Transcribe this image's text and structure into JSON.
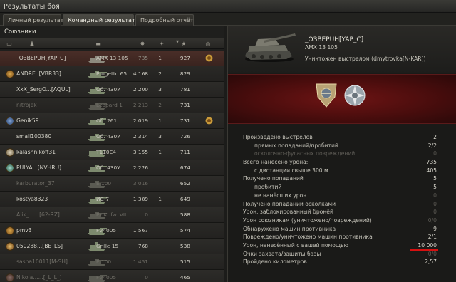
{
  "window": {
    "title": "Результаты боя"
  },
  "tabs": [
    {
      "label": "Личный результат",
      "active": false
    },
    {
      "label": "Командный результат",
      "active": true
    },
    {
      "label": "Подробный отчёт",
      "active": false
    }
  ],
  "team": {
    "title": "Союзники",
    "players": [
      {
        "name": "_OЗВЕРUH[YAP_C]",
        "vehicle": "AMX 13 105",
        "damage": "735",
        "kills": "1",
        "xp": "927",
        "self": true,
        "dead": false,
        "clan": false,
        "medal": true
      },
      {
        "name": "ANDRE..[VBR33]",
        "vehicle": "Progetto 65",
        "damage": "4 168",
        "kills": "2",
        "xp": "829",
        "self": false,
        "dead": false,
        "clan": true,
        "medal": false
      },
      {
        "name": "XxX_SergO...[AQUL]",
        "vehicle": "Об. 430У",
        "damage": "2 200",
        "kills": "3",
        "xp": "781",
        "self": false,
        "dead": false,
        "clan": false,
        "medal": false
      },
      {
        "name": "nitrojek",
        "vehicle": "Leopard 1",
        "damage": "2 213",
        "kills": "2",
        "xp": "731",
        "self": false,
        "dead": true,
        "clan": false,
        "medal": false
      },
      {
        "name": "Genik59",
        "vehicle": "Об. 261",
        "damage": "2 019",
        "kills": "1",
        "xp": "731",
        "self": false,
        "dead": false,
        "clan": true,
        "medal": true
      },
      {
        "name": "small100380",
        "vehicle": "Об. 430У",
        "damage": "2 314",
        "kills": "3",
        "xp": "726",
        "self": false,
        "dead": false,
        "clan": false,
        "medal": false
      },
      {
        "name": "kalashnikoff31",
        "vehicle": "T110E4",
        "damage": "3 155",
        "kills": "1",
        "xp": "711",
        "self": false,
        "dead": false,
        "clan": true,
        "medal": false
      },
      {
        "name": "PULYA...[NVHRU]",
        "vehicle": "Об. 430У",
        "damage": "2 226",
        "kills": "",
        "xp": "674",
        "self": false,
        "dead": false,
        "clan": true,
        "medal": false
      },
      {
        "name": "karburator_37",
        "vehicle": "E 100",
        "damage": "3 016",
        "kills": "",
        "xp": "652",
        "self": false,
        "dead": true,
        "clan": false,
        "medal": false
      },
      {
        "name": "kostya8323",
        "vehicle": "ИС-7",
        "damage": "1 389",
        "kills": "1",
        "xp": "649",
        "self": false,
        "dead": false,
        "clan": false,
        "medal": false
      },
      {
        "name": "Alik_......[62-RZ]",
        "vehicle": "Pz.Kpfw. VII",
        "damage": "0",
        "kills": "",
        "xp": "588",
        "self": false,
        "dead": true,
        "clan": false,
        "medal": false
      },
      {
        "name": "pmv3",
        "vehicle": "FV4005",
        "damage": "1 567",
        "kills": "",
        "xp": "574",
        "self": false,
        "dead": false,
        "clan": true,
        "medal": false
      },
      {
        "name": "050288...[BE_LS]",
        "vehicle": "Grille 15",
        "damage": "768",
        "kills": "",
        "xp": "538",
        "self": false,
        "dead": false,
        "clan": true,
        "medal": false
      },
      {
        "name": "sasha10011[M-SH]",
        "vehicle": "E 100",
        "damage": "1 451",
        "kills": "",
        "xp": "515",
        "self": false,
        "dead": true,
        "clan": false,
        "medal": false
      },
      {
        "name": "Nikola......[_L_L_]",
        "vehicle": "FV4005",
        "damage": "0",
        "kills": "",
        "xp": "465",
        "self": false,
        "dead": true,
        "clan": true,
        "medal": false
      }
    ]
  },
  "detail": {
    "player_name": "_OЗВЕРUH[YAP_C]",
    "vehicle": "AMX 13 105",
    "status": "Уничтожен выстрелом (dmytrovka[N-KAR])",
    "stats": [
      {
        "label": "Произведено выстрелов",
        "value": "2",
        "sub": false,
        "dim": false
      },
      {
        "label": "прямых попаданий/пробитий",
        "value": "2/2",
        "sub": true,
        "dim": false
      },
      {
        "label": "осколочно-фугасных повреждений",
        "value": "0",
        "sub": true,
        "dim": true
      },
      {
        "label": "Всего нанесено урона:",
        "value": "735",
        "sub": false,
        "dim": false
      },
      {
        "label": "с дистанции свыше 300 м",
        "value": "405",
        "sub": true,
        "dim": false
      },
      {
        "label": "Получено попаданий",
        "value": "5",
        "sub": false,
        "dim": false
      },
      {
        "label": "пробитий",
        "value": "5",
        "sub": true,
        "dim": false
      },
      {
        "label": "не нанёсших урон",
        "value": "0",
        "sub": true,
        "dim": true
      },
      {
        "label": "Получено попаданий осколками",
        "value": "0",
        "sub": false,
        "dim": true
      },
      {
        "label": "Урон, заблокированный бронёй",
        "value": "0",
        "sub": false,
        "dim": true
      },
      {
        "label": "Урон союзникам (уничтожено/повреждений)",
        "value": "0/0",
        "sub": false,
        "dim": true
      },
      {
        "label": "Обнаружено машин противника",
        "value": "9",
        "sub": false,
        "dim": false
      },
      {
        "label": "Повреждено/уничтожено машин противника",
        "value": "2/1",
        "sub": false,
        "dim": false
      },
      {
        "label": "Урон, нанесённый с вашей помощью",
        "value": "10 000",
        "sub": false,
        "dim": false,
        "highlight": true
      },
      {
        "label": "Очки захвата/защиты базы",
        "value": "0/0",
        "sub": false,
        "dim": true
      },
      {
        "label": "Пройдено километров",
        "value": "2,57",
        "sub": false,
        "dim": false
      }
    ]
  },
  "colors": {
    "self_row": "#4a2e28",
    "red_band": "#6e1414",
    "highlight_underline": "#d61010"
  }
}
